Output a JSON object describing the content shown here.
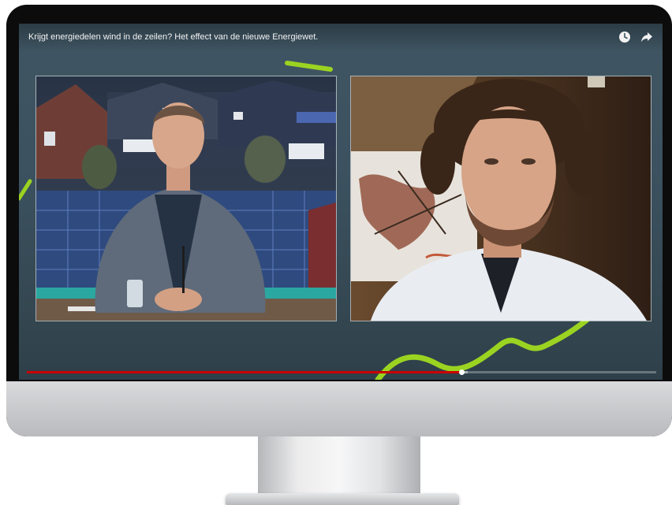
{
  "video": {
    "title": "Krijgt energiedelen wind in de zeilen? Het effect van de nieuwe Energiewet.",
    "watch_later_icon": "clock-icon",
    "share_icon": "share-arrow-icon",
    "progress_played": 0.69,
    "progress_buffered": 0.7
  },
  "participants": {
    "left": {
      "description_icon": "studio-presenter-image"
    },
    "right": {
      "description_icon": "remote-guest-image"
    }
  },
  "colors": {
    "screen_bg": "#3f5562",
    "accent_green": "#9bd321",
    "progress_red": "#cc0000",
    "bezel": "#0c0c0c",
    "chin": "#cfd0d2"
  }
}
